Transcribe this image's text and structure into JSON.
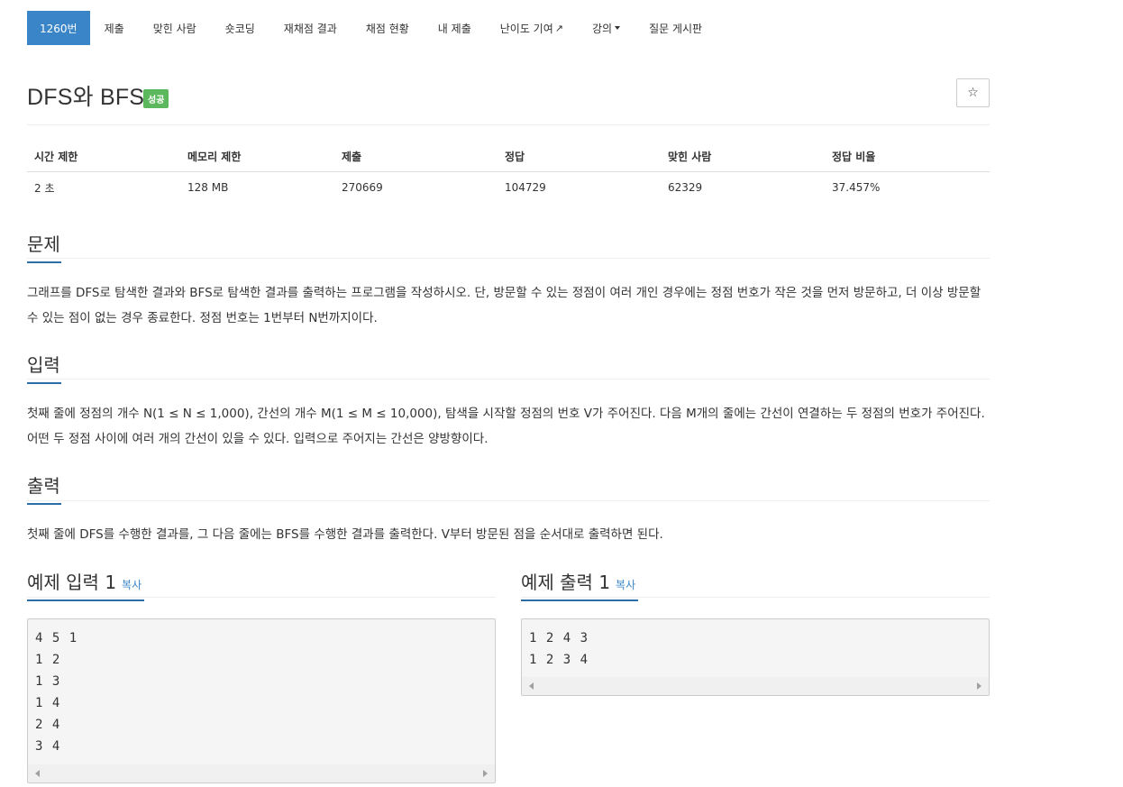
{
  "nav": {
    "items": [
      {
        "label": "1260번"
      },
      {
        "label": "제출"
      },
      {
        "label": "맞힌 사람"
      },
      {
        "label": "숏코딩"
      },
      {
        "label": "재채점 결과"
      },
      {
        "label": "채점 현황"
      },
      {
        "label": "내 제출"
      },
      {
        "label": "난이도 기여"
      },
      {
        "label": "강의"
      },
      {
        "label": "질문 게시판"
      }
    ]
  },
  "problem": {
    "title": "DFS와 BFS",
    "badge": "성공",
    "star": "☆"
  },
  "info": {
    "headers": [
      "시간 제한",
      "메모리 제한",
      "제출",
      "정답",
      "맞힌 사람",
      "정답 비율"
    ],
    "values": [
      "2 초",
      "128 MB",
      "270669",
      "104729",
      "62329",
      "37.457%"
    ]
  },
  "sections": {
    "problem": {
      "heading": "문제",
      "text": "그래프를 DFS로 탐색한 결과와 BFS로 탐색한 결과를 출력하는 프로그램을 작성하시오. 단, 방문할 수 있는 정점이 여러 개인 경우에는 정점 번호가 작은 것을 먼저 방문하고, 더 이상 방문할 수 있는 점이 없는 경우 종료한다. 정점 번호는 1번부터 N번까지이다."
    },
    "input": {
      "heading": "입력",
      "text": "첫째 줄에 정점의 개수 N(1 ≤ N ≤ 1,000), 간선의 개수 M(1 ≤ M ≤ 10,000), 탐색을 시작할 정점의 번호 V가 주어진다. 다음 M개의 줄에는 간선이 연결하는 두 정점의 번호가 주어진다. 어떤 두 정점 사이에 여러 개의 간선이 있을 수 있다. 입력으로 주어지는 간선은 양방향이다."
    },
    "output": {
      "heading": "출력",
      "text": "첫째 줄에 DFS를 수행한 결과를, 그 다음 줄에는 BFS를 수행한 결과를 출력한다. V부터 방문된 점을 순서대로 출력하면 된다."
    }
  },
  "samples": {
    "input": {
      "heading": "예제 입력 1",
      "copy": "복사",
      "lines": [
        "4 5 1",
        "1 2",
        "1 3",
        "1 4",
        "2 4",
        "3 4"
      ]
    },
    "output": {
      "heading": "예제 출력 1",
      "copy": "복사",
      "lines": [
        "1 2 4 3",
        "1 2 3 4"
      ]
    }
  }
}
